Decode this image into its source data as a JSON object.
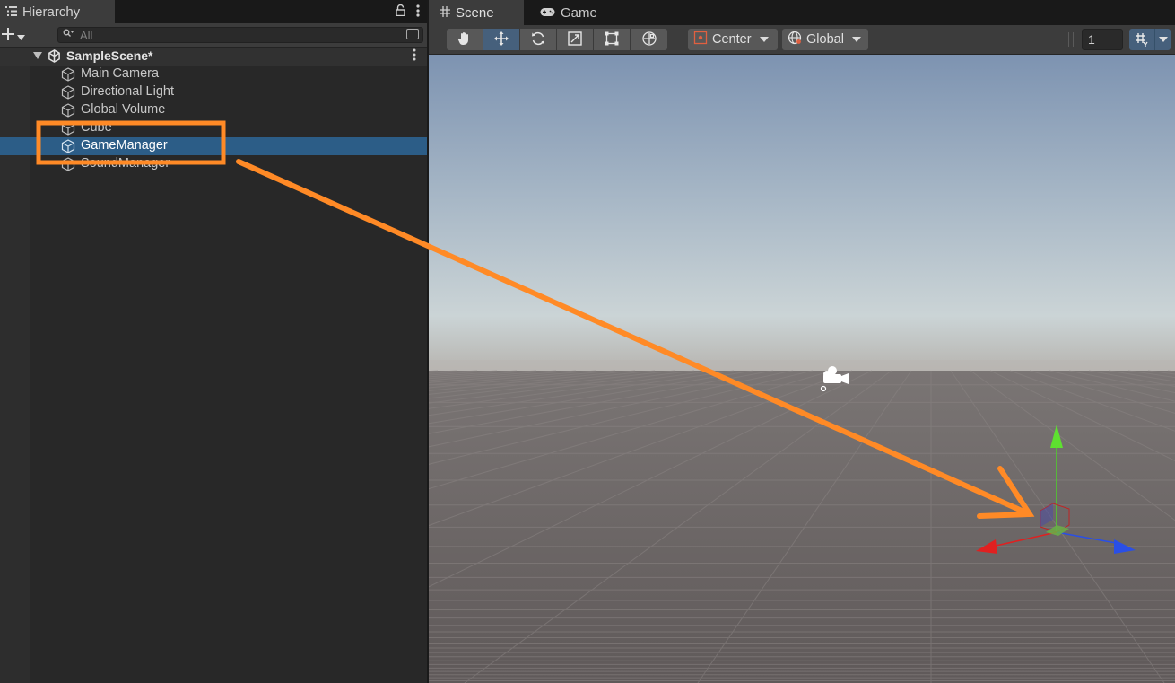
{
  "hierarchy": {
    "tab_title": "Hierarchy",
    "search_placeholder": "All",
    "scene_name": "SampleScene*",
    "items": [
      {
        "label": "Main Camera"
      },
      {
        "label": "Directional Light"
      },
      {
        "label": "Global Volume"
      },
      {
        "label": "Cube"
      },
      {
        "label": "GameManager",
        "selected": true
      },
      {
        "label": "SoundManager"
      }
    ]
  },
  "scene_view": {
    "tabs": [
      {
        "label": "Scene",
        "active": true
      },
      {
        "label": "Game",
        "active": false
      }
    ],
    "tools": [
      "hand",
      "move",
      "rotate",
      "scale",
      "rect",
      "transform"
    ],
    "active_tool": "move",
    "pivot_mode": "Center",
    "pivot_rotation": "Global",
    "grid_size": "1"
  },
  "colors": {
    "selection": "#2c5d87",
    "annotation": "#ff8a26",
    "axis_x": "#e02020",
    "axis_y": "#4ed02a",
    "axis_z": "#2a4fe6"
  }
}
